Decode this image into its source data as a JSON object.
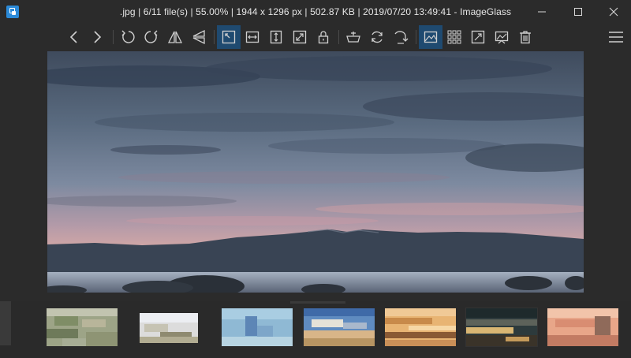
{
  "window": {
    "title": ".jpg  |  6/11 file(s)  |  55.00%  |  1944 x 1296 px  |  502.87 KB  |  2019/07/20 13:49:41  -  ImageGlass",
    "controls": [
      "minimize-icon",
      "maximize-icon",
      "close-icon"
    ]
  },
  "toolbar": {
    "buttons": [
      {
        "name": "previous-image",
        "icon": "chevron-left-icon"
      },
      {
        "name": "next-image",
        "icon": "chevron-right-icon"
      },
      {
        "name": "rotate-left",
        "icon": "rotate-left-icon"
      },
      {
        "name": "rotate-right",
        "icon": "rotate-right-icon"
      },
      {
        "name": "flip-horizontal",
        "icon": "flip-horizontal-icon"
      },
      {
        "name": "flip-vertical",
        "icon": "flip-vertical-icon"
      },
      {
        "name": "auto-zoom",
        "icon": "auto-zoom-icon",
        "active": true
      },
      {
        "name": "zoom-to-width",
        "icon": "scale-width-icon"
      },
      {
        "name": "zoom-to-height",
        "icon": "scale-height-icon"
      },
      {
        "name": "zoom-to-fit",
        "icon": "scale-fit-icon"
      },
      {
        "name": "lock-zoom",
        "icon": "lock-icon"
      },
      {
        "name": "open-with",
        "icon": "open-with-icon"
      },
      {
        "name": "refresh",
        "icon": "refresh-icon"
      },
      {
        "name": "goto-image",
        "icon": "goto-icon"
      },
      {
        "name": "thumbnail-bar",
        "icon": "thumbnail-bar-icon",
        "active": true
      },
      {
        "name": "checkerboard",
        "icon": "grid-icon"
      },
      {
        "name": "fullscreen",
        "icon": "fullscreen-icon"
      },
      {
        "name": "slideshow",
        "icon": "slideshow-icon"
      },
      {
        "name": "delete",
        "icon": "trash-icon"
      },
      {
        "name": "main-menu",
        "icon": "hamburger-menu-icon"
      }
    ]
  },
  "colors": {
    "background": "#2b2b2b",
    "active_button": "#1f4a70",
    "icon": "#d0d0d0",
    "app_icon": "#2b8ad8"
  },
  "thumbnails": {
    "count_visible": 7,
    "selected_index": 5
  }
}
